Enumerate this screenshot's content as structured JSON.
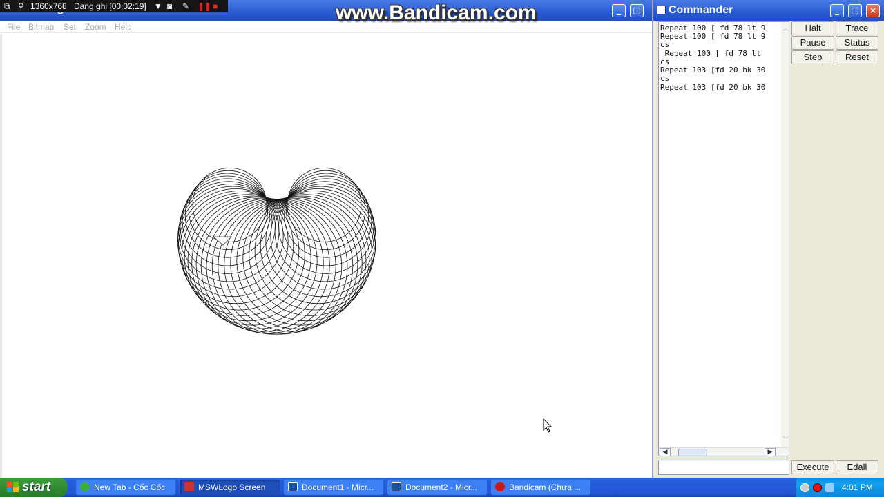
{
  "bandicam": {
    "resolution": "1360x768",
    "recording_label": "Đang ghi [00:02:19]",
    "watermark": "www.Bandicam.com"
  },
  "logo_window": {
    "title": "MSWLogo Screen",
    "menu": [
      "File",
      "Bitmap",
      "Set",
      "Zoom",
      "Help"
    ]
  },
  "commander": {
    "title": "Commander",
    "history": [
      "Repeat 100 [ fd 78 lt 9",
      "Repeat 100 [ fd 78 lt 9",
      "cs",
      " Repeat 100 [ fd 78 lt",
      "cs",
      "Repeat 103 [fd 20 bk 30",
      "cs",
      "Repeat 103 [fd 20 bk 30"
    ],
    "input_value": "",
    "buttons": {
      "halt": "Halt",
      "trace": "Trace",
      "pause": "Pause",
      "status": "Status",
      "step": "Step",
      "reset": "Reset",
      "execute": "Execute",
      "edall": "Edall"
    }
  },
  "taskbar": {
    "start": "start",
    "tasks": [
      {
        "label": "New Tab - Cốc Cốc",
        "icon": "coccoc-icon",
        "active": false
      },
      {
        "label": "MSWLogo Screen",
        "icon": "mswlogo-icon",
        "active": true
      },
      {
        "label": "Document1 - Micr...",
        "icon": "word-icon",
        "active": false
      },
      {
        "label": "Document2 - Micr...",
        "icon": "word-icon",
        "active": false
      },
      {
        "label": "Bandicam (Chưa ...",
        "icon": "bandicam-icon",
        "active": false
      }
    ],
    "clock": "4:01 PM"
  },
  "colors": {
    "titlebar": "#2a5ad0",
    "taskbar": "#245edb",
    "start": "#2f8a2f",
    "tray": "#12a0ee"
  }
}
